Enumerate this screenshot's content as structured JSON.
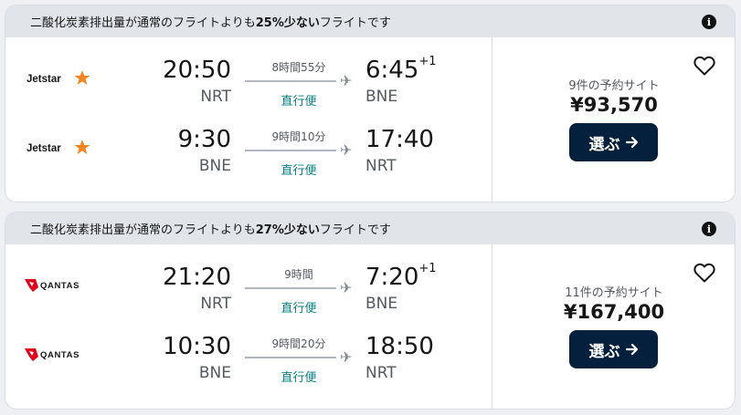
{
  "results": [
    {
      "banner": {
        "prefix": "二酸化炭素排出量が通常のフライトよりも",
        "highlight": "25%少ない",
        "suffix": "フライトです"
      },
      "airline": "Jetstar",
      "legs": [
        {
          "dep_time": "20:50",
          "dep_code": "NRT",
          "duration": "8時間55分",
          "stops": "直行便",
          "arr_time": "6:45",
          "arr_offset": "+1",
          "arr_code": "BNE"
        },
        {
          "dep_time": "9:30",
          "dep_code": "BNE",
          "duration": "9時間10分",
          "stops": "直行便",
          "arr_time": "17:40",
          "arr_offset": "",
          "arr_code": "NRT"
        }
      ],
      "sites": "9件の予約サイト",
      "price": "¥93,570",
      "select_label": "選ぶ"
    },
    {
      "banner": {
        "prefix": "二酸化炭素排出量が通常のフライトよりも",
        "highlight": "27%少ない",
        "suffix": "フライトです"
      },
      "airline": "QANTAS",
      "legs": [
        {
          "dep_time": "21:20",
          "dep_code": "NRT",
          "duration": "9時間",
          "stops": "直行便",
          "arr_time": "7:20",
          "arr_offset": "+1",
          "arr_code": "BNE"
        },
        {
          "dep_time": "10:30",
          "dep_code": "BNE",
          "duration": "9時間20分",
          "stops": "直行便",
          "arr_time": "18:50",
          "arr_offset": "",
          "arr_code": "NRT"
        }
      ],
      "sites": "11件の予約サイト",
      "price": "¥167,400",
      "select_label": "選ぶ"
    }
  ],
  "colors": {
    "accent": "#05203c",
    "direct": "#0b7f7f",
    "jetstar_orange": "#f5841f",
    "qantas_red": "#e0001b"
  },
  "icons": {
    "info": "info-icon",
    "favorite": "heart-icon",
    "plane": "plane-icon",
    "arrow": "arrow-right-icon"
  }
}
